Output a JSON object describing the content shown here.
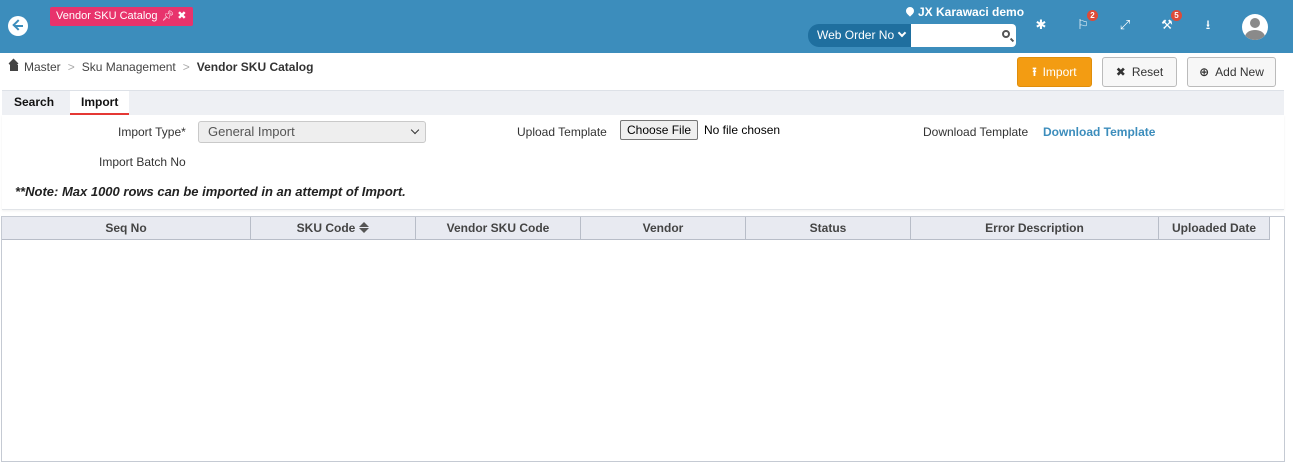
{
  "header": {
    "open_tab": {
      "label": "Vendor SKU Catalog",
      "pin_icon": "pin-icon",
      "close_icon": "close-icon"
    },
    "location": "JX Karawaci demo",
    "search": {
      "type_label": "Web Order No",
      "value": ""
    },
    "notifications": {
      "flag_count": "2",
      "tools_count": "5"
    },
    "accent_color": "#3c8dbc"
  },
  "breadcrumb": {
    "items": [
      "Master",
      "Sku Management"
    ],
    "current": "Vendor SKU Catalog"
  },
  "actions": {
    "import": "Import",
    "reset": "Reset",
    "add_new": "Add New"
  },
  "subtabs": {
    "search": "Search",
    "import": "Import",
    "active": "Import"
  },
  "form": {
    "import_type_label": "Import Type*",
    "import_type_value": "General Import",
    "upload_template_label": "Upload Template",
    "choose_file": "Choose File",
    "no_file": "No file chosen",
    "download_template_label": "Download Template",
    "download_template_link": "Download Template",
    "import_batch_label": "Import Batch No",
    "note": "**Note: Max 1000 rows can be imported in an attempt of Import."
  },
  "grid": {
    "columns": [
      "Seq No",
      "SKU Code",
      "Vendor SKU Code",
      "Vendor",
      "Status",
      "Error Description",
      "Uploaded Date"
    ],
    "rows": []
  }
}
